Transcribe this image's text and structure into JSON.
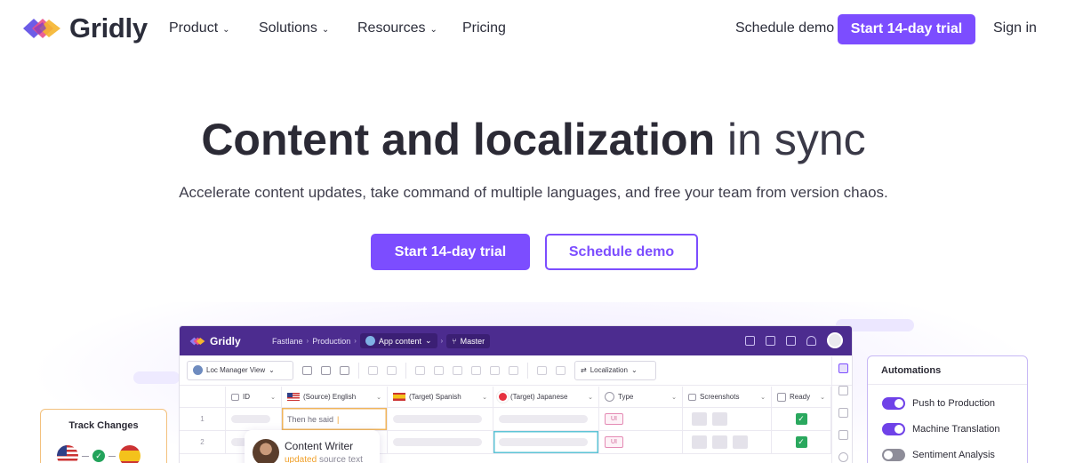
{
  "brand": {
    "name": "Gridly"
  },
  "nav": {
    "items": [
      {
        "label": "Product",
        "has_dropdown": true
      },
      {
        "label": "Solutions",
        "has_dropdown": true
      },
      {
        "label": "Resources",
        "has_dropdown": true
      },
      {
        "label": "Pricing",
        "has_dropdown": false
      }
    ],
    "schedule_demo": "Schedule demo",
    "trial": "Start 14-day trial",
    "sign_in": "Sign in"
  },
  "hero": {
    "title_bold": "Content and localization",
    "title_light": "in sync",
    "subtitle": "Accelerate content updates, take command of multiple languages, and free your team from version chaos.",
    "cta_primary": "Start 14-day trial",
    "cta_secondary": "Schedule demo"
  },
  "colors": {
    "accent": "#7c4dff",
    "app_header": "#4c2c8f",
    "track_border": "#f3c17d",
    "automation_border": "#c7b8f5"
  },
  "app": {
    "logo": "Gridly",
    "breadcrumb": [
      "Fastlane",
      "Production"
    ],
    "grid_name": "App content",
    "branch": "Master",
    "view": "Loc Manager View",
    "localization": "Localization",
    "columns": [
      "ID",
      "(Source) English",
      "(Target) Spanish",
      "(Target) Japanese",
      "Type",
      "Screenshots",
      "Ready"
    ],
    "rows": [
      {
        "id": "1",
        "source": "Then he said",
        "type": "UI",
        "ready": true
      },
      {
        "id": "2",
        "source": "",
        "type": "UI",
        "ready": true
      }
    ]
  },
  "track_changes": {
    "title": "Track Changes"
  },
  "content_writer": {
    "name": "Content Writer",
    "status_highlight": "updated",
    "status_rest": "source text"
  },
  "automations": {
    "title": "Automations",
    "items": [
      {
        "label": "Push to Production",
        "on": true
      },
      {
        "label": "Machine Translation",
        "on": true
      },
      {
        "label": "Sentiment Analysis",
        "on": false
      }
    ]
  }
}
